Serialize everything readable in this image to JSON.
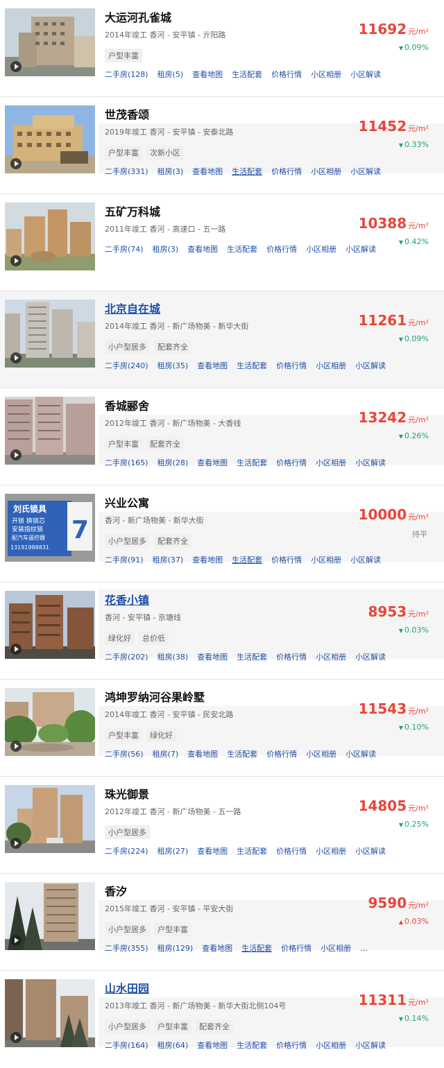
{
  "colors": {
    "price": "#e8463a",
    "down": "#26a269",
    "link": "#1f4fa8"
  },
  "price_unit": "元/m²",
  "communities": [
    {
      "name": "大运河孔雀城",
      "meta": "2014年竣工  香河 - 安平镇 - 亓阳路",
      "tags": [
        "户型丰富"
      ],
      "price": "11692",
      "change": "0.09%",
      "trend": "down",
      "links": [
        "二手房(128)",
        "租房(5)",
        "查看地图",
        "生活配套",
        "价格行情",
        "小区相册",
        "小区解读"
      ]
    },
    {
      "name": "世茂香颂",
      "meta": "2019年竣工  香河 - 安平镇 - 安泰北路",
      "tags": [
        "户型丰富",
        "次新小区"
      ],
      "price": "11452",
      "change": "0.33%",
      "trend": "down",
      "links": [
        "二手房(331)",
        "租房(3)",
        "查看地图",
        "生活配套",
        "价格行情",
        "小区相册",
        "小区解读"
      ]
    },
    {
      "name": "五矿万科城",
      "meta": "2011年竣工  香河 - 高速口 - 五一路",
      "tags": [],
      "price": "10388",
      "change": "0.42%",
      "trend": "down",
      "links": [
        "二手房(74)",
        "租房(3)",
        "查看地图",
        "生活配套",
        "价格行情",
        "小区相册",
        "小区解读"
      ]
    },
    {
      "name": "北京自在城",
      "meta": "2014年竣工  香河 - 新广场物美 - 新华大街",
      "tags": [
        "小户型居多",
        "配套齐全"
      ],
      "price": "11261",
      "change": "0.09%",
      "trend": "down",
      "links": [
        "二手房(240)",
        "租房(35)",
        "查看地图",
        "生活配套",
        "价格行情",
        "小区相册",
        "小区解读"
      ]
    },
    {
      "name": "香城郦舍",
      "meta": "2012年竣工  香河 - 新广场物美 - 大香线",
      "tags": [
        "户型丰富",
        "配套齐全"
      ],
      "price": "13242",
      "change": "0.26%",
      "trend": "down",
      "links": [
        "二手房(165)",
        "租房(28)",
        "查看地图",
        "生活配套",
        "价格行情",
        "小区相册",
        "小区解读"
      ]
    },
    {
      "name": "兴业公寓",
      "meta": "香河 - 新广场物美 - 新华大街",
      "tags": [
        "小户型居多",
        "配套齐全"
      ],
      "price": "10000",
      "change": "持平",
      "trend": "flat",
      "links": [
        "二手房(91)",
        "租房(37)",
        "查看地图",
        "生活配套",
        "价格行情",
        "小区相册",
        "小区解读"
      ]
    },
    {
      "name": "花香小镇",
      "meta": "香河 - 安平镇 - 京塘线",
      "tags": [
        "绿化好",
        "总价低"
      ],
      "price": "8953",
      "change": "0.03%",
      "trend": "down",
      "links": [
        "二手房(202)",
        "租房(38)",
        "查看地图",
        "生活配套",
        "价格行情",
        "小区相册",
        "小区解读"
      ]
    },
    {
      "name": "鸿坤罗纳河谷果岭墅",
      "meta": "2014年竣工  香河 - 安平镇 - 民安北路",
      "tags": [
        "户型丰富",
        "绿化好"
      ],
      "price": "11543",
      "change": "0.10%",
      "trend": "down",
      "links": [
        "二手房(56)",
        "租房(7)",
        "查看地图",
        "生活配套",
        "价格行情",
        "小区相册",
        "小区解读"
      ]
    },
    {
      "name": "珠光御景",
      "meta": "2012年竣工  香河 - 新广场物美 - 五一路",
      "tags": [
        "小户型居多"
      ],
      "price": "14805",
      "change": "0.25%",
      "trend": "down",
      "links": [
        "二手房(224)",
        "租房(27)",
        "查看地图",
        "生活配套",
        "价格行情",
        "小区相册",
        "小区解读"
      ]
    },
    {
      "name": "香汐",
      "meta": "2015年竣工  香河 - 安平镇 - 平安大街",
      "tags": [
        "小户型居多",
        "户型丰富"
      ],
      "price": "9590",
      "change": "0.03%",
      "trend": "up",
      "links": [
        "二手房(355)",
        "租房(129)",
        "查看地图",
        "生活配套",
        "价格行情",
        "小区相册",
        "..."
      ]
    },
    {
      "name": "山水田园",
      "meta": "2013年竣工  香河 - 新广场物美 - 新华大街北侧104号",
      "tags": [
        "小户型居多",
        "户型丰富",
        "配套齐全"
      ],
      "price": "11311",
      "change": "0.14%",
      "trend": "down",
      "links": [
        "二手房(164)",
        "租房(64)",
        "查看地图",
        "生活配套",
        "价格行情",
        "小区相册",
        "小区解读"
      ]
    }
  ],
  "sign": {
    "line1": "刘氏锁具",
    "line2": "开锁 换锁芯",
    "line3": "安装指纹锁",
    "line4": "配汽车遥控器",
    "phone": "13191988831",
    "number": "7"
  }
}
